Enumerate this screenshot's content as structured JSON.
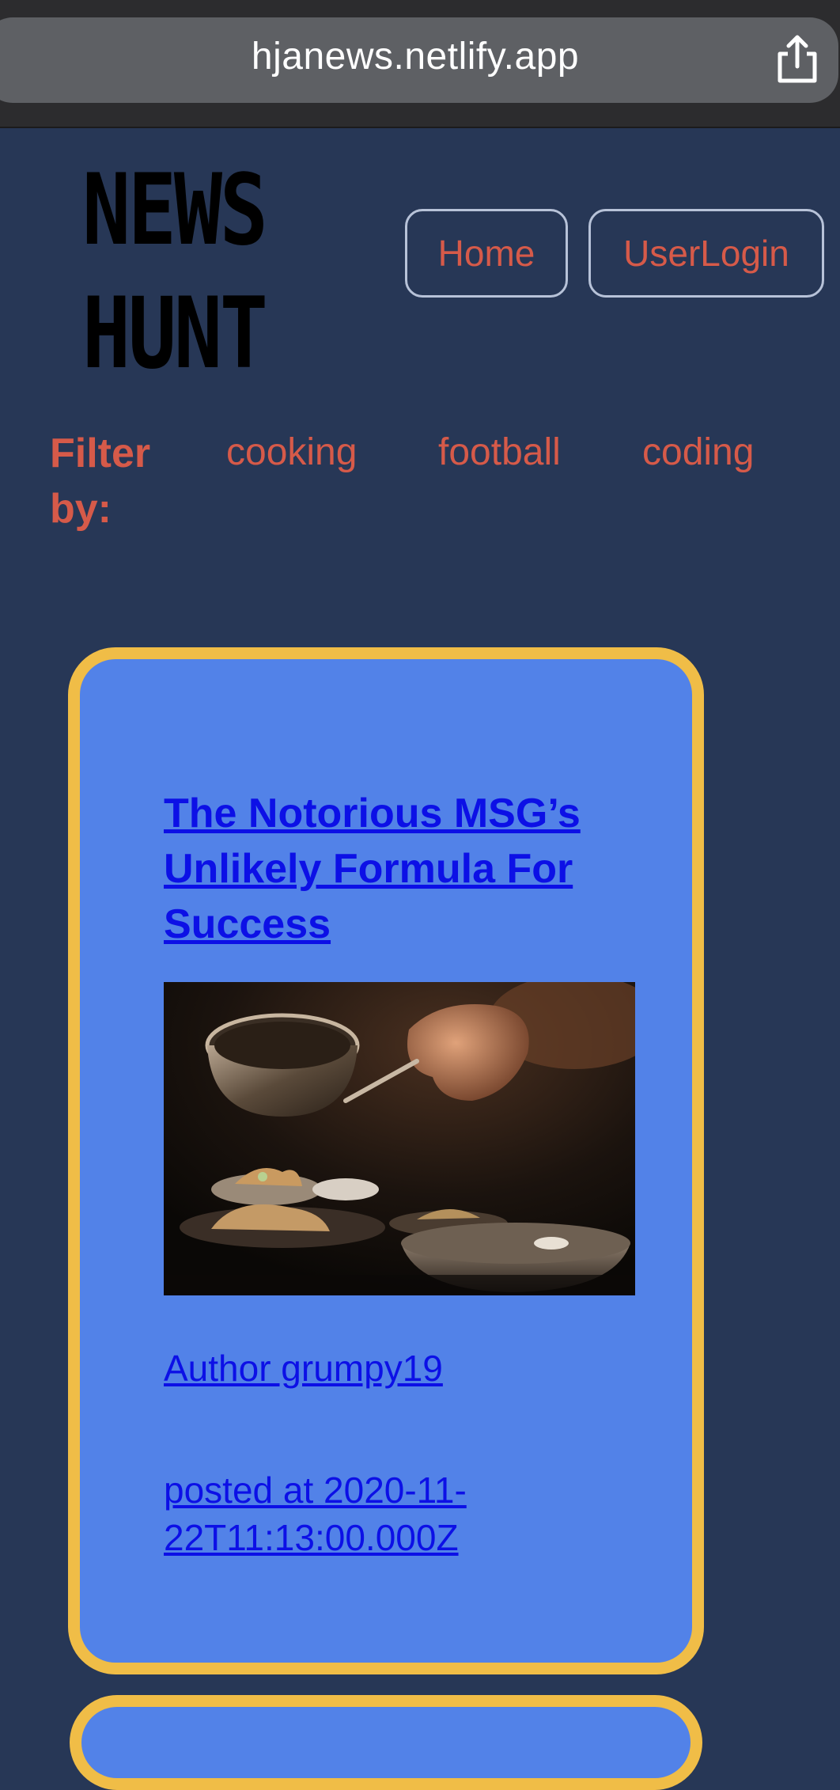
{
  "browser": {
    "url": "hjanews.netlify.app",
    "share_icon": "share-icon"
  },
  "header": {
    "logo": "NEWS\nHUNT",
    "nav": {
      "home": "Home",
      "login": "UserLogin"
    }
  },
  "filter": {
    "label": "Filter by:",
    "topics": [
      "cooking",
      "football",
      "coding"
    ]
  },
  "articles": [
    {
      "title": "The Notorious MSG’s Unlikely Formula For Success",
      "author": "Author grumpy19",
      "posted": "posted at 2020-11-22T11:13:00.000Z",
      "image": "cooking-photo"
    }
  ],
  "colors": {
    "page_background": "#273756",
    "card_background": "#5282e8",
    "card_border": "#f0bd47",
    "accent_red": "#d65a49",
    "link_blue": "#0c10e6"
  }
}
